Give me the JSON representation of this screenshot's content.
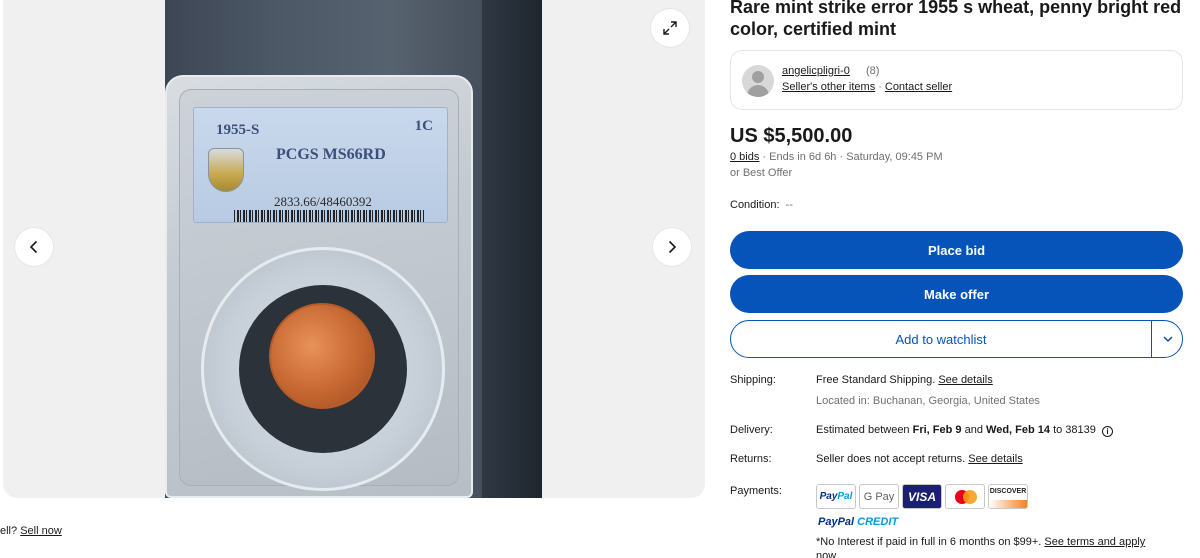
{
  "gallery": {
    "slab_label": {
      "year": "1955-S",
      "denomination": "1C",
      "grade": "PCGS MS66RD",
      "cert": "2833.66/48460392"
    },
    "icons": {
      "expand": "expand-icon",
      "prev": "chevron-left-icon",
      "next": "chevron-right-icon"
    }
  },
  "sell_prompt": {
    "prefix": "ell?",
    "link": "Sell now"
  },
  "listing": {
    "title": "Rare mint strike error 1955 s wheat, penny bright red color, certified mint"
  },
  "seller": {
    "name": "angelicpligri-0",
    "feedback_count": "(8)",
    "other_items": "Seller's other items",
    "contact": "Contact seller"
  },
  "pricing": {
    "price": "US $5,500.00",
    "bids": "0 bids",
    "ends": "Ends in 6d 6h · Saturday, 09:45 PM",
    "best_offer": "or Best Offer",
    "condition_label": "Condition:",
    "condition_value": "--"
  },
  "actions": {
    "place_bid": "Place bid",
    "make_offer": "Make offer",
    "watchlist": "Add to watchlist"
  },
  "details": {
    "shipping_label": "Shipping:",
    "shipping_value": "Free Standard Shipping.",
    "shipping_link": "See details",
    "location": "Located in: Buchanan, Georgia, United States",
    "delivery_label": "Delivery:",
    "delivery_prefix": "Estimated between",
    "delivery_start": "Fri, Feb 9",
    "delivery_and": "and",
    "delivery_end": "Wed, Feb 14",
    "delivery_suffix": "to 38139",
    "returns_label": "Returns:",
    "returns_value": "Seller does not accept returns.",
    "returns_link": "See details",
    "payments_label": "Payments:"
  },
  "payments": {
    "paypal_a": "Pay",
    "paypal_b": "Pal",
    "gpay": "G Pay",
    "visa": "VISA",
    "discover": "DISCOVER",
    "paypal_credit_a": "PayPal",
    "paypal_credit_b": "CREDIT",
    "finance_text": "*No Interest if paid in full in 6 months on $99+.",
    "finance_link": "See terms and apply now"
  },
  "colors": {
    "primary": "#0654ba",
    "text": "#191919",
    "muted": "#707070"
  }
}
